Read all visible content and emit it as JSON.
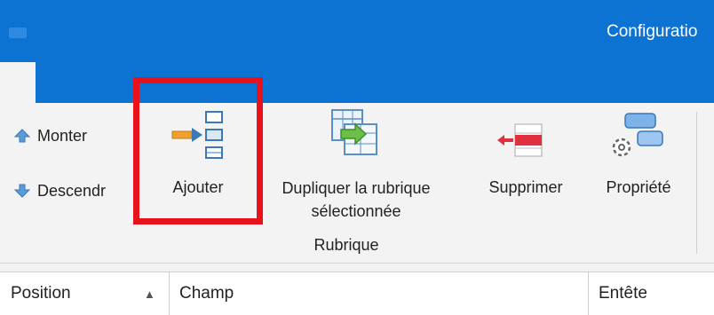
{
  "window": {
    "title": "Configuratio"
  },
  "ribbon": {
    "buttons": {
      "monter": {
        "label": "Monter",
        "icon": "arrow-up-icon"
      },
      "descendre": {
        "label": "Descendr",
        "icon": "arrow-down-icon"
      },
      "ajouter": {
        "label": "Ajouter",
        "icon": "add-field-icon"
      },
      "dupliquer": {
        "label_line1": "Dupliquer la rubrique",
        "label_line2": "sélectionnée",
        "icon": "duplicate-table-icon"
      },
      "supprimer": {
        "label": "Supprimer",
        "icon": "delete-row-icon"
      },
      "propriete": {
        "label": "Propriété",
        "icon": "properties-gear-icon"
      }
    },
    "group_label": "Rubrique"
  },
  "grid": {
    "columns": [
      "Position",
      "Champ",
      "Entête"
    ],
    "sort_indicator": "▲"
  },
  "colors": {
    "title_bar": "#0d73d3",
    "highlight": "#e8121d",
    "ribbon_bg": "#f3f3f3"
  }
}
